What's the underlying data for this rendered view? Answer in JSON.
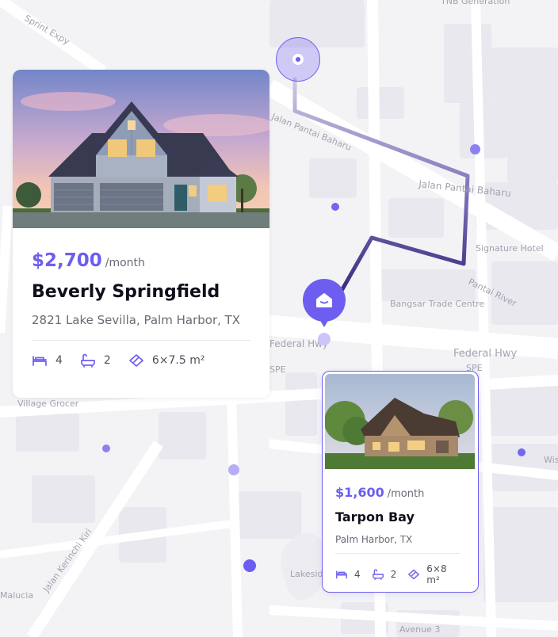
{
  "map": {
    "labels": [
      "Sprint Expy",
      "TNB Generation",
      "Jalan Pantai Baharu",
      "Jalan Pantai Baharu",
      "Signature Hotel",
      "Pantai River",
      "Bangsar Trade Centre",
      "Federal Hwy",
      "Federal Hwy",
      "SPE",
      "SPE",
      "Village Grocer",
      "Jalan Kerinchi Kiri",
      "Lakeside",
      "Avenue 3",
      "Wis",
      "Jalan Pantai Baharu",
      "Malucia"
    ]
  },
  "listings": [
    {
      "price": "$2,700",
      "period": "/month",
      "name": "Beverly Springfield",
      "address": "2821 Lake Sevilla, Palm Harbor, TX",
      "beds": "4",
      "baths": "2",
      "area": "6×7.5 m²",
      "photo_icon": "suburban-house-photo"
    },
    {
      "price": "$1,600",
      "period": "/month",
      "name": "Tarpon Bay",
      "address": "Palm Harbor, TX",
      "beds": "4",
      "baths": "2",
      "area": "6×8 m²",
      "photo_icon": "stone-house-photo"
    }
  ],
  "colors": {
    "accent": "#6d5ef0",
    "route_start": "#c4c0dc",
    "route_end": "#3a2f7d",
    "map_bg": "#f3f3f6"
  },
  "icons": [
    "location-pin-icon",
    "home-pin-icon",
    "bed-icon",
    "bath-icon",
    "area-icon"
  ]
}
